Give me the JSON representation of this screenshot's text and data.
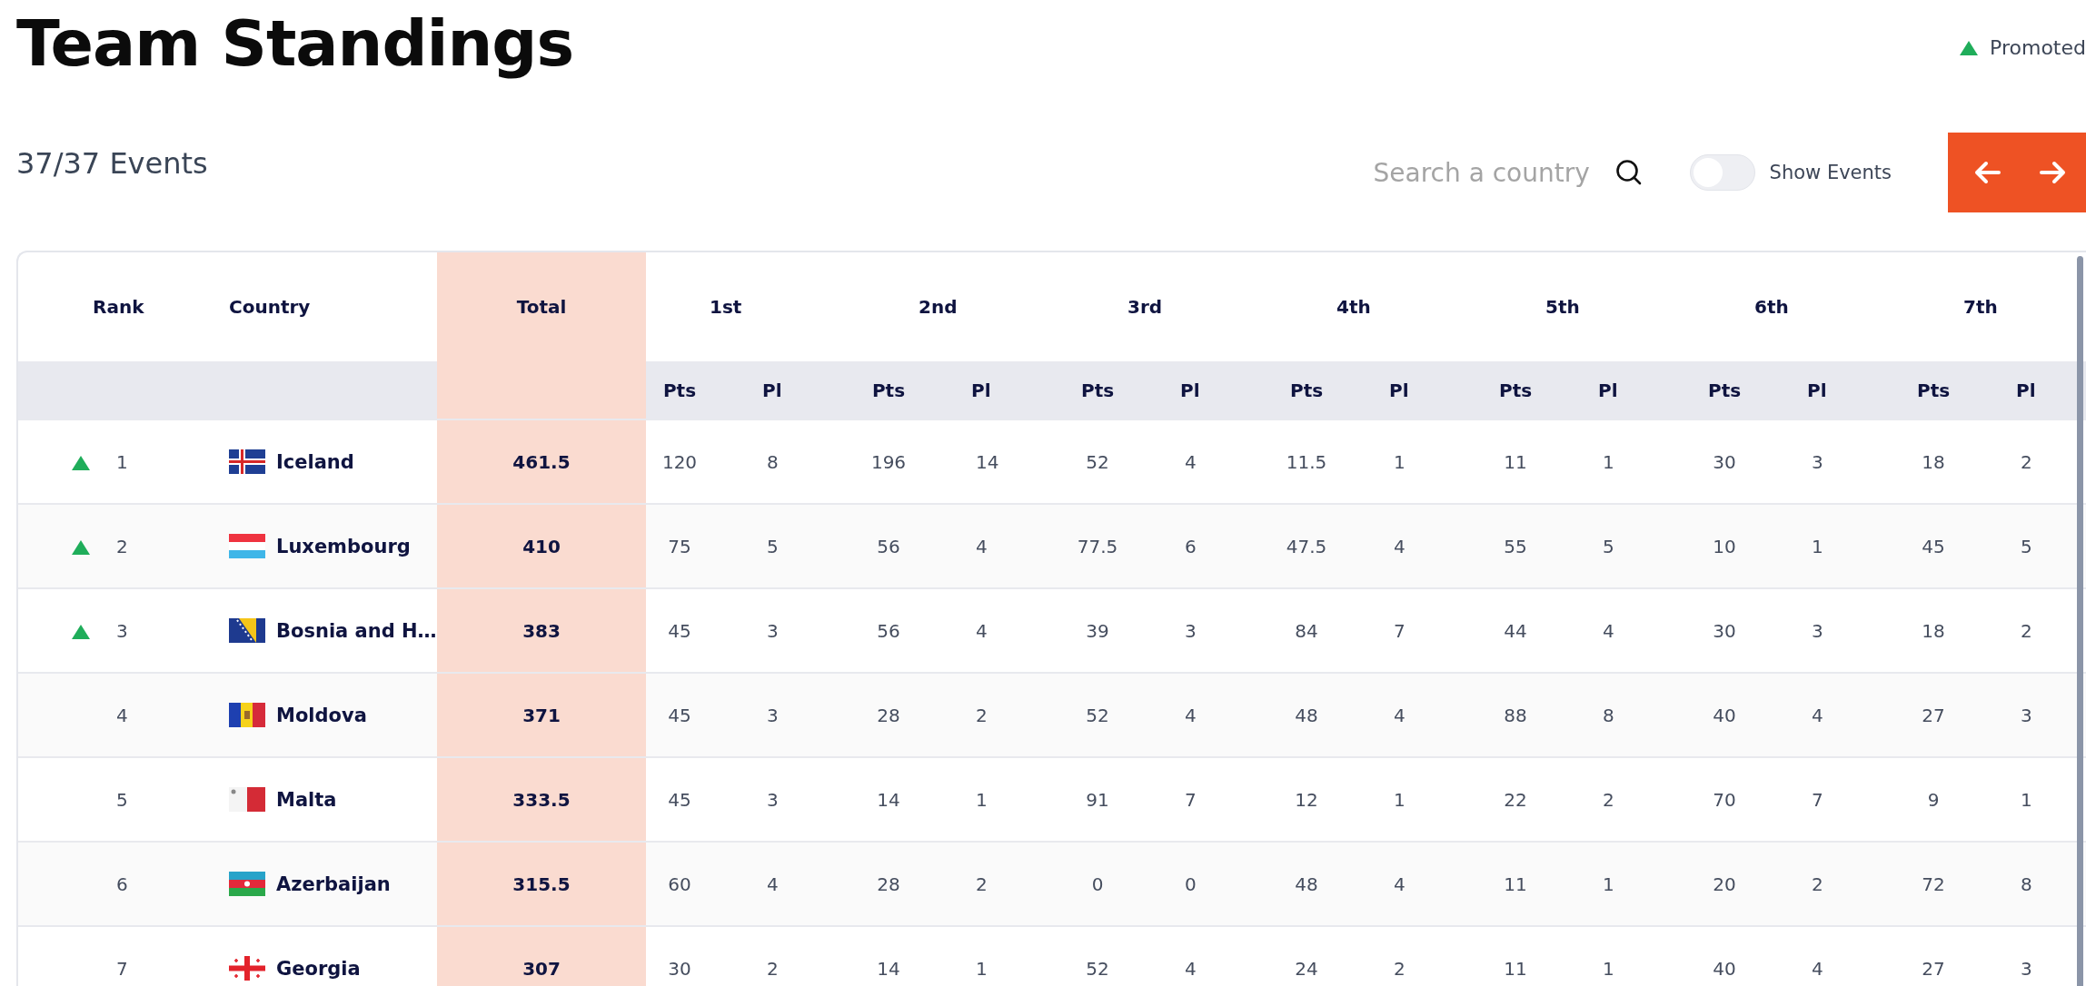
{
  "title": "Team Standings",
  "legend": {
    "label": "Promoted"
  },
  "events": "37/37 Events",
  "search": {
    "placeholder": "Search a country"
  },
  "toggle": {
    "label": "Show Events",
    "on": false
  },
  "columns": {
    "rank": "Rank",
    "country": "Country",
    "total": "Total",
    "groups": [
      {
        "label": "1st",
        "sub": [
          "Pts",
          "Pl"
        ]
      },
      {
        "label": "2nd",
        "sub": [
          "Pts",
          "Pl"
        ]
      },
      {
        "label": "3rd",
        "sub": [
          "Pts",
          "Pl"
        ]
      },
      {
        "label": "4th",
        "sub": [
          "Pts",
          "Pl"
        ]
      },
      {
        "label": "5th",
        "sub": [
          "Pts",
          "Pl"
        ]
      },
      {
        "label": "6th",
        "sub": [
          "Pts",
          "Pl"
        ]
      },
      {
        "label": "7th",
        "sub": [
          "Pts",
          "Pl"
        ]
      }
    ]
  },
  "rows": [
    {
      "promoted": true,
      "rank": "1",
      "country": "Iceland",
      "total": "461.5",
      "cells": [
        "120",
        "8",
        "196",
        "14",
        "52",
        "4",
        "11.5",
        "1",
        "11",
        "1",
        "30",
        "3",
        "18",
        "2"
      ]
    },
    {
      "promoted": true,
      "rank": "2",
      "country": "Luxembourg",
      "total": "410",
      "cells": [
        "75",
        "5",
        "56",
        "4",
        "77.5",
        "6",
        "47.5",
        "4",
        "55",
        "5",
        "10",
        "1",
        "45",
        "5"
      ]
    },
    {
      "promoted": true,
      "rank": "3",
      "country": "Bosnia and H…",
      "total": "383",
      "cells": [
        "45",
        "3",
        "56",
        "4",
        "39",
        "3",
        "84",
        "7",
        "44",
        "4",
        "30",
        "3",
        "18",
        "2"
      ]
    },
    {
      "promoted": false,
      "rank": "4",
      "country": "Moldova",
      "total": "371",
      "cells": [
        "45",
        "3",
        "28",
        "2",
        "52",
        "4",
        "48",
        "4",
        "88",
        "8",
        "40",
        "4",
        "27",
        "3"
      ]
    },
    {
      "promoted": false,
      "rank": "5",
      "country": "Malta",
      "total": "333.5",
      "cells": [
        "45",
        "3",
        "14",
        "1",
        "91",
        "7",
        "12",
        "1",
        "22",
        "2",
        "70",
        "7",
        "9",
        "1"
      ]
    },
    {
      "promoted": false,
      "rank": "6",
      "country": "Azerbaijan",
      "total": "315.5",
      "cells": [
        "60",
        "4",
        "28",
        "2",
        "0",
        "0",
        "48",
        "4",
        "11",
        "1",
        "20",
        "2",
        "72",
        "8"
      ]
    },
    {
      "promoted": false,
      "rank": "7",
      "country": "Georgia",
      "total": "307",
      "cells": [
        "30",
        "2",
        "14",
        "1",
        "52",
        "4",
        "24",
        "2",
        "11",
        "1",
        "40",
        "4",
        "27",
        "3"
      ]
    }
  ]
}
